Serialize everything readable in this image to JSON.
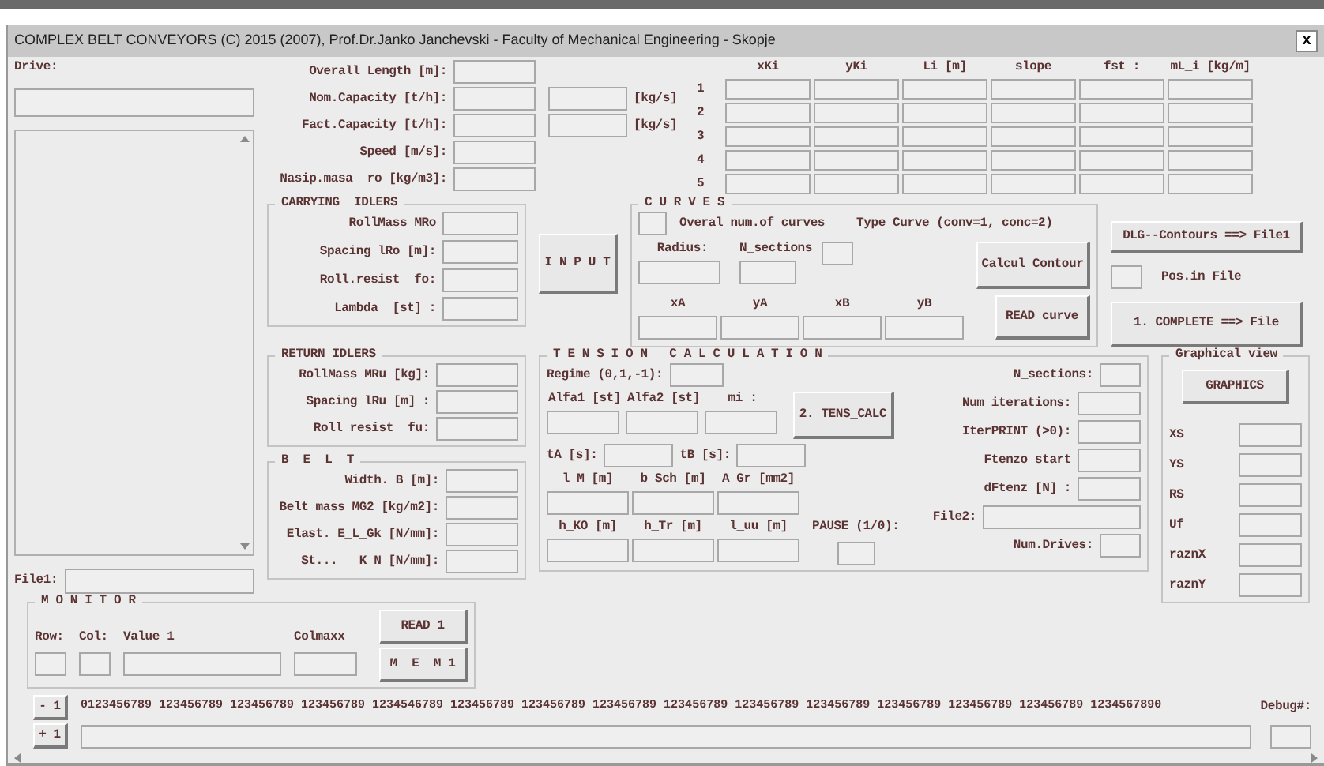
{
  "window": {
    "title": "COMPLEX BELT CONVEYORS (C) 2015 (2007), Prof.Dr.Janko Janchevski - Faculty of Mechanical Engineering - Skopje",
    "close": "x"
  },
  "drive": {
    "label": "Drive:",
    "file_label": "File1:"
  },
  "main_fields": [
    {
      "label": "Overall Length [m]:"
    },
    {
      "label": "Nom.Capacity [t/h]:",
      "unit": "[kg/s]"
    },
    {
      "label": "Fact.Capacity [t/h]:",
      "unit": "[kg/s]"
    },
    {
      "label": "Speed [m/s]:"
    },
    {
      "label": "Nasip.masa  ro [kg/m3]:"
    }
  ],
  "table": {
    "columns": [
      "xKi",
      "yKi",
      "Li [m]",
      "slope",
      "fst :",
      "mL_i [kg/m]"
    ],
    "rows": [
      "1",
      "2",
      "3",
      "4",
      "5"
    ]
  },
  "carrying_idlers": {
    "title": "CARRYING  IDLERS",
    "fields": [
      {
        "label": "RollMass MRo"
      },
      {
        "label": "Spacing lRo [m]:"
      },
      {
        "label": "Roll.resist  fo:"
      },
      {
        "label": "Lambda  [st] :"
      }
    ]
  },
  "return_idlers": {
    "title": "RETURN IDLERS",
    "fields": [
      {
        "label": "RollMass MRu [kg]:"
      },
      {
        "label": "Spacing lRu [m] :"
      },
      {
        "label": "Roll resist  fu:"
      }
    ]
  },
  "belt": {
    "title": "B  E  L  T",
    "fields": [
      {
        "label": "Width. B [m]:"
      },
      {
        "label": "Belt mass MG2 [kg/m2]:"
      },
      {
        "label": "Elast. E_L_Gk [N/mm]:"
      },
      {
        "label": "St...   K_N [N/mm]:"
      }
    ]
  },
  "input_button": "I N P U T",
  "curves": {
    "title": "C U R V E S",
    "count_label": "Overal num.of curves",
    "type_label": "Type_Curve (conv=1, conc=2)",
    "fields": [
      {
        "label": "Radius:"
      },
      {
        "label": "N_sections"
      }
    ],
    "contour_button": "Calcul_Contour",
    "points": [
      {
        "label": "xA"
      },
      {
        "label": "yA"
      },
      {
        "label": "xB"
      },
      {
        "label": "yB"
      }
    ],
    "read_button": "READ curve"
  },
  "file_actions": {
    "contours_button": "DLG--Contours ==> File1",
    "position_label": "Pos.in File",
    "complete_button": "1. COMPLETE ==> File"
  },
  "tension": {
    "title": "T E N S I O N   C A L C U L A T I O N",
    "regime": {
      "label": "Regime (0,1,-1):"
    },
    "angle_fields": [
      {
        "label": "Alfa1 [st]"
      },
      {
        "label": "Alfa2 [st]"
      },
      {
        "label": "mi :"
      }
    ],
    "button": "2. TENS_CALC",
    "time_fields": [
      {
        "label": "tA [s]:"
      },
      {
        "label": "tB [s]:"
      }
    ],
    "dimension_fields": [
      {
        "label": "l_M [m]"
      },
      {
        "label": "b_Sch [m]"
      },
      {
        "label": "A_Gr [mm2]"
      }
    ],
    "height_fields": [
      {
        "label": "h_KO [m]"
      },
      {
        "label": "h_Tr [m]"
      },
      {
        "label": "l_uu [m]"
      }
    ],
    "pause": {
      "label": "PAUSE (1/0):"
    },
    "settings": [
      {
        "label": "N_sections:",
        "kind": "short"
      },
      {
        "label": "Num_iterations:",
        "kind": "medium"
      },
      {
        "label": "IterPRINT (>0):",
        "kind": "medium"
      },
      {
        "label": "Ftenzo_start",
        "kind": "medium"
      },
      {
        "label": "dFtenz [N] :",
        "kind": "medium"
      },
      {
        "label": "File2:",
        "kind": "wide"
      },
      {
        "label": "Num.Drives:",
        "kind": "short"
      }
    ]
  },
  "graphical_view": {
    "title": "Graphical view",
    "button": "GRAPHICS",
    "fields": [
      {
        "label": "XS"
      },
      {
        "label": "YS"
      },
      {
        "label": "RS"
      },
      {
        "label": "Uf"
      },
      {
        "label": "raznX"
      },
      {
        "label": "raznY"
      }
    ]
  },
  "monitor": {
    "title": "M O N I T O R",
    "fields": [
      {
        "label": "Row:",
        "kind": "small"
      },
      {
        "label": "Col:",
        "kind": "small"
      },
      {
        "label": "Value 1",
        "kind": "wide"
      },
      {
        "label": "Colmaxx",
        "kind": "medium"
      }
    ],
    "read_button": "READ 1",
    "memory_button": "M  E  M 1"
  },
  "ruler": {
    "minus_button": "- 1",
    "plus_button": "+ 1",
    "text": "0123456789 123456789 123456789 123456789 1234546789 123456789 123456789 123456789 123456789 123456789 123456789 123456789 123456789 123456789 1234567890",
    "debug_label": "Debug#:"
  }
}
